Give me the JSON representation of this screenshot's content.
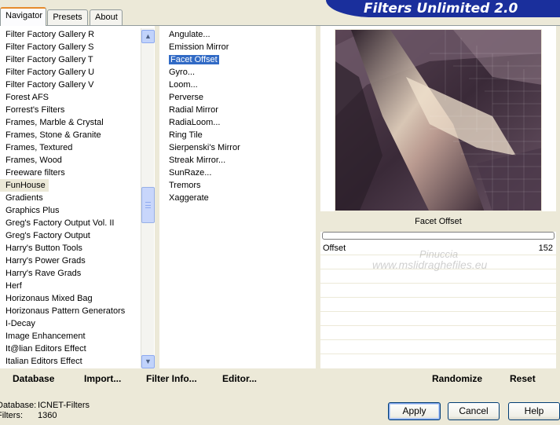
{
  "tabs": [
    {
      "label": "Navigator"
    },
    {
      "label": "Presets"
    },
    {
      "label": "About"
    }
  ],
  "brand": "Filters Unlimited 2.0",
  "categories": [
    "Filter Factory Gallery R",
    "Filter Factory Gallery S",
    "Filter Factory Gallery T",
    "Filter Factory Gallery U",
    "Filter Factory Gallery V",
    "Forest AFS",
    "Forrest's Filters",
    "Frames, Marble & Crystal",
    "Frames, Stone & Granite",
    "Frames, Textured",
    "Frames, Wood",
    "Freeware filters",
    "FunHouse",
    "Gradients",
    "Graphics Plus",
    "Greg's Factory Output Vol. II",
    "Greg's Factory Output",
    "Harry's Button Tools",
    "Harry's Power Grads",
    "Harry's Rave Grads",
    "Herf",
    "Horizonaus Mixed Bag",
    "Horizonaus Pattern Generators",
    "I-Decay",
    "Image Enhancement",
    "It@lian Editors Effect",
    "Italian Editors Effect"
  ],
  "selected_category": "FunHouse",
  "filters": [
    "Angulate...",
    "Emission Mirror",
    "Facet Offset",
    "Gyro...",
    "Loom...",
    "Perverse",
    "Radial Mirror",
    "RadiaLoom...",
    "Ring Tile",
    "Sierpenski's Mirror",
    "Streak Mirror...",
    "SunRaze...",
    "Tremors",
    "Xaggerate"
  ],
  "selected_filter": "Facet Offset",
  "preview": {
    "filter_title": "Facet Offset",
    "params": [
      {
        "name": "Offset",
        "value": "152"
      }
    ],
    "watermark_line1": "Pinuccia",
    "watermark_line2": "www.mslidraghefiles.eu"
  },
  "bottom_bar": {
    "database": "Database",
    "import": "Import...",
    "filter_info": "Filter Info...",
    "editor": "Editor...",
    "randomize": "Randomize",
    "reset": "Reset"
  },
  "status": {
    "database_label": "Database:",
    "database_value": "ICNET-Filters",
    "filters_label": "Filters:",
    "filters_value": "1360"
  },
  "dialog": {
    "apply": "Apply",
    "cancel": "Cancel",
    "help": "Help"
  },
  "icons": {
    "scroll_up": "scroll-up-arrow-icon",
    "scroll_down": "scroll-down-arrow-icon"
  }
}
